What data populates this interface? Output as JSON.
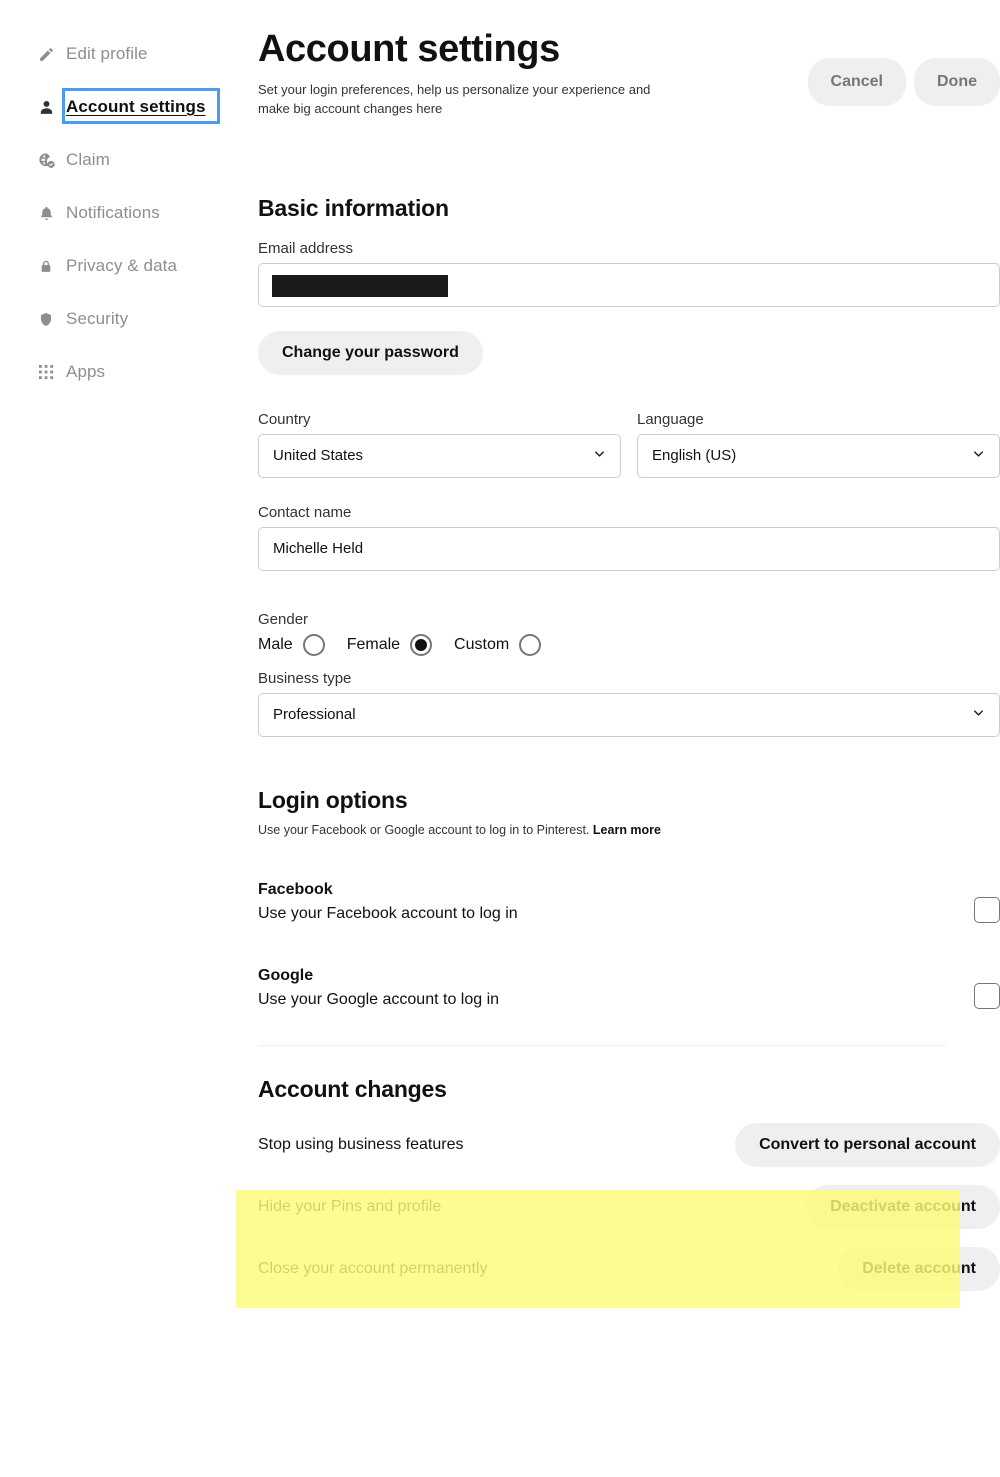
{
  "sidebar": {
    "items": [
      {
        "label": "Edit profile",
        "icon": "pencil-icon",
        "active": false
      },
      {
        "label": "Account settings",
        "icon": "person-icon",
        "active": true
      },
      {
        "label": "Claim",
        "icon": "globe-check-icon",
        "active": false
      },
      {
        "label": "Notifications",
        "icon": "bell-icon",
        "active": false
      },
      {
        "label": "Privacy & data",
        "icon": "lock-icon",
        "active": false
      },
      {
        "label": "Security",
        "icon": "shield-icon",
        "active": false
      },
      {
        "label": "Apps",
        "icon": "grid-dots-icon",
        "active": false
      }
    ]
  },
  "header": {
    "title": "Account settings",
    "subtitle": "Set your login preferences, help us personalize your experience and make big account changes here",
    "cancel_label": "Cancel",
    "done_label": "Done"
  },
  "basic_information": {
    "heading": "Basic information",
    "email_label": "Email address",
    "email_value": "",
    "email_redacted": true,
    "change_password_label": "Change your password",
    "country_label": "Country",
    "country_value": "United States",
    "language_label": "Language",
    "language_value": "English (US)",
    "contact_name_label": "Contact name",
    "contact_name_value": "Michelle Held",
    "gender_label": "Gender",
    "gender_options": [
      {
        "label": "Male",
        "selected": false
      },
      {
        "label": "Female",
        "selected": true
      },
      {
        "label": "Custom",
        "selected": false
      }
    ],
    "business_type_label": "Business type",
    "business_type_value": "Professional"
  },
  "login_options": {
    "heading": "Login options",
    "description": "Use your Facebook or Google account to log in to Pinterest.",
    "learn_more_label": "Learn more",
    "providers": [
      {
        "name": "Facebook",
        "description": "Use your Facebook account to log in",
        "checked": false
      },
      {
        "name": "Google",
        "description": "Use your Google account to log in",
        "checked": false
      }
    ]
  },
  "account_changes": {
    "heading": "Account changes",
    "rows": [
      {
        "label": "Stop using business features",
        "button": "Convert to personal account"
      },
      {
        "label": "Hide your Pins and profile",
        "button": "Deactivate account"
      },
      {
        "label": "Close your account permanently",
        "button": "Delete account"
      }
    ]
  },
  "colors": {
    "highlight": "#fdfb7b",
    "focus_ring": "#4a9cf0",
    "button_bg": "#efefef",
    "muted_text": "#8e8e8e"
  }
}
